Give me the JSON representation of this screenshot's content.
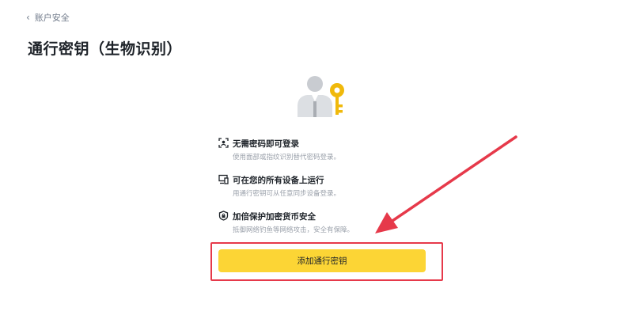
{
  "nav": {
    "back_label": "账户安全",
    "back_icon": "chevron-left-icon"
  },
  "page": {
    "title": "通行密钥（生物识别）"
  },
  "illustration": {
    "icon": "user-with-key-icon",
    "key_color": "#f0b90b",
    "person_color": "#c9ccd1"
  },
  "features": [
    {
      "icon": "face-scan-icon",
      "title": "无需密码即可登录",
      "description": "使用面部或指纹识别替代密码登录。"
    },
    {
      "icon": "devices-icon",
      "title": "可在您的所有设备上运行",
      "description": "用通行密钥可从任意同步设备登录。"
    },
    {
      "icon": "shield-icon",
      "title": "加倍保护加密货币安全",
      "description": "抵御网络钓鱼等网络攻击，安全有保障。"
    }
  ],
  "actions": {
    "add_passkey_label": "添加通行密钥"
  },
  "colors": {
    "accent": "#fcd535",
    "annotation": "#e6394a",
    "text_primary": "#1e2329",
    "text_secondary": "#9aa0aa"
  }
}
